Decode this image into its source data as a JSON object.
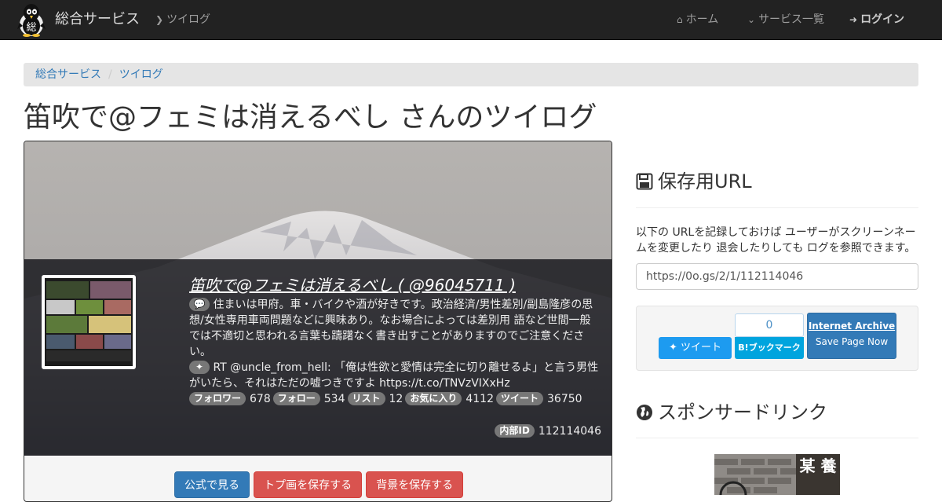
{
  "navbar": {
    "brand": "総合サービス",
    "logo_glyph": "総",
    "links": {
      "tsuilog": "ツイログ",
      "home": "ホーム",
      "services": "サービス一覧",
      "login": "ログイン"
    }
  },
  "breadcrumb": {
    "items": [
      "総合サービス",
      "ツイログ"
    ],
    "separator": "/"
  },
  "page_title": "笛吹で@フェミは消えるべし さんのツイログ",
  "profile": {
    "name": "笛吹で@フェミは消えるべし ( @96045711 )",
    "bio": "住まいは甲府。車・バイクや酒が好きです。政治経済/男性差別/副島隆彦の思想/女性専用車両問題などに興味あり。なお場合によっては差別用 語など世間一般では不適切と思われる言葉も躊躇なく書き出すことがありますのでご注意ください。",
    "latest_tweet": "RT @uncle_from_hell: 「俺は性欲と愛情は完全に切り離せるよ」と言う男性がいたら、それはただの嘘つきですよ https://t.co/TNVzVIXxHz",
    "stats": {
      "followers_label": "フォロワー",
      "followers": "678",
      "following_label": "フォロー",
      "following": "534",
      "lists_label": "リスト",
      "lists": "12",
      "favorites_label": "お気に入り",
      "favorites": "4112",
      "tweets_label": "ツイート",
      "tweets": "36750"
    },
    "internal_id_label": "内部ID",
    "internal_id": "112114046"
  },
  "actions": {
    "view_official": "公式で見る",
    "save_avatar": "トプ画を保存する",
    "save_banner": "背景を保存する"
  },
  "sidebar": {
    "save_heading": "保存用URL",
    "save_desc": "以下の URLを記録しておけば ユーザーがスクリーンネームを変更したり 退会したりしても ログを参照できます。",
    "save_url": "https://0o.gs/2/1/112114046",
    "tweet_button": "ツイート",
    "hatena_count": "0",
    "hatena_button": "B!ブックマーク",
    "ia_title": "Internet Archive",
    "ia_action": "Save Page Now",
    "sponsor_heading": "スポンサードリンク",
    "ad_text": "某 養"
  },
  "colors": {
    "navbar_bg": "#222222",
    "link": "#337ab7",
    "danger": "#d9534f",
    "twitter": "#1d9bf0",
    "hatena": "#00a4de"
  },
  "icons": {
    "tsuilog": "chevron-circle-icon",
    "home": "home-icon",
    "services": "chevron-down-icon",
    "login": "sign-in-icon",
    "save": "floppy-disk-icon",
    "sponsor": "globe-icon",
    "bio": "comment-icon",
    "tweet": "twitter-bird-icon"
  }
}
